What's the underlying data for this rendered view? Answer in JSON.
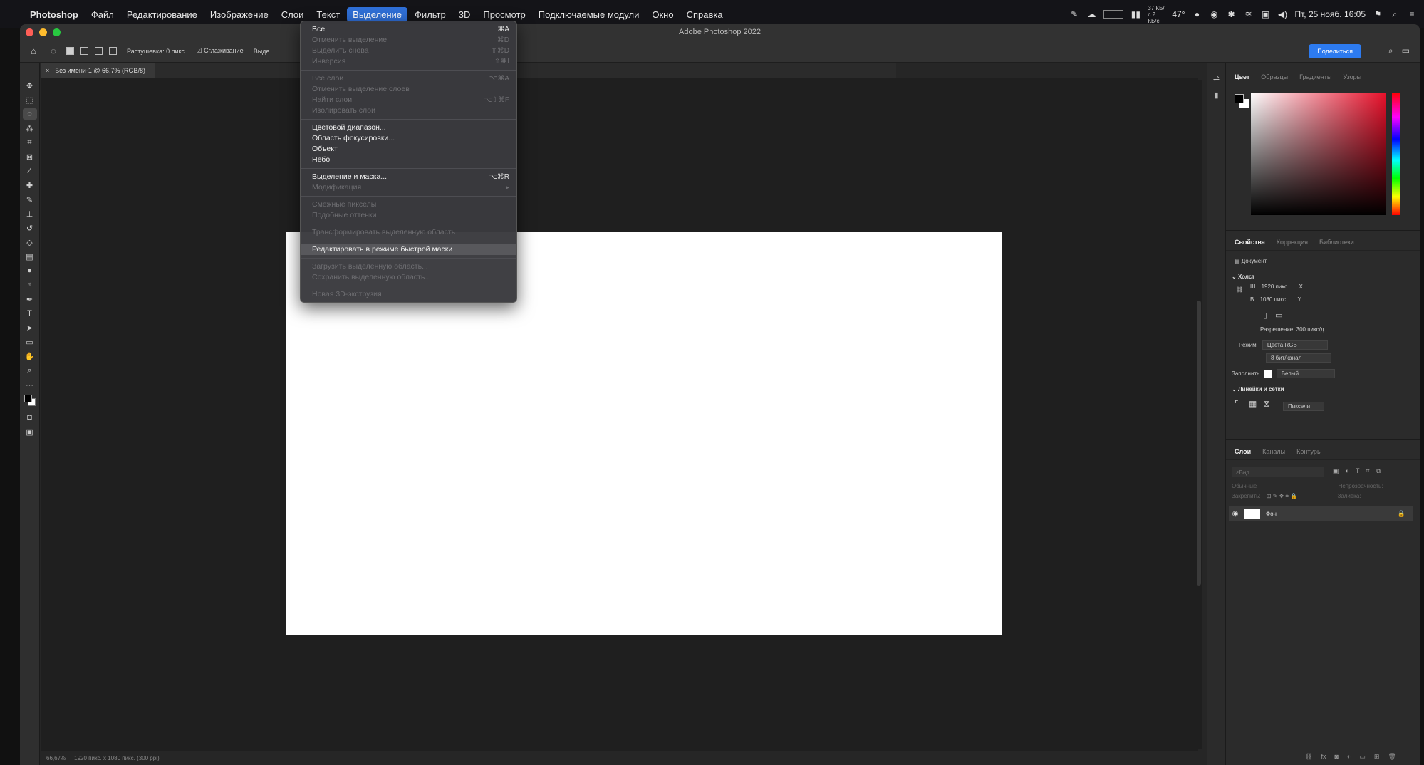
{
  "menubar": {
    "app_name": "Photoshop",
    "items": [
      "Файл",
      "Редактирование",
      "Изображение",
      "Слои",
      "Текст",
      "Выделение",
      "Фильтр",
      "3D",
      "Просмотр",
      "Подключаемые модули",
      "Окно",
      "Справка"
    ],
    "active_index": 5,
    "status": {
      "net_speed": "37 КБ/с 2 КБ/с",
      "temperature": "47°",
      "clock": "Пт, 25 нояб. 16:05"
    }
  },
  "window": {
    "title": "Adobe Photoshop 2022"
  },
  "options_bar": {
    "feather": "Растушевка: 0 пикс.",
    "anti_alias": "☑ Сглаживание",
    "select_label": "Выде",
    "share_button": "Поделиться"
  },
  "document_tab": {
    "name": "Без имени-1 @ 66,7% (RGB/8)"
  },
  "status_bar": {
    "zoom": "66,67%",
    "info": "1920 пикс. x 1080 пикс. (300 ppi)"
  },
  "select_menu": {
    "groups": [
      [
        {
          "label": "Все",
          "shortcut": "⌘A",
          "enabled": true
        },
        {
          "label": "Отменить выделение",
          "shortcut": "⌘D",
          "enabled": false
        },
        {
          "label": "Выделить снова",
          "shortcut": "⇧⌘D",
          "enabled": false
        },
        {
          "label": "Инверсия",
          "shortcut": "⇧⌘I",
          "enabled": false
        }
      ],
      [
        {
          "label": "Все слои",
          "shortcut": "⌥⌘A",
          "enabled": false
        },
        {
          "label": "Отменить выделение слоев",
          "shortcut": "",
          "enabled": false
        },
        {
          "label": "Найти слои",
          "shortcut": "⌥⇧⌘F",
          "enabled": false
        },
        {
          "label": "Изолировать слои",
          "shortcut": "",
          "enabled": false
        }
      ],
      [
        {
          "label": "Цветовой диапазон...",
          "shortcut": "",
          "enabled": true
        },
        {
          "label": "Область фокусировки...",
          "shortcut": "",
          "enabled": true
        },
        {
          "label": "Объект",
          "shortcut": "",
          "enabled": true
        },
        {
          "label": "Небо",
          "shortcut": "",
          "enabled": true
        }
      ],
      [
        {
          "label": "Выделение и маска...",
          "shortcut": "⌥⌘R",
          "enabled": true
        },
        {
          "label": "Модификация",
          "shortcut": "▸",
          "enabled": false
        }
      ],
      [
        {
          "label": "Смежные пикселы",
          "shortcut": "",
          "enabled": false
        },
        {
          "label": "Подобные оттенки",
          "shortcut": "",
          "enabled": false
        }
      ],
      [
        {
          "label": "Трансформировать выделенную область",
          "shortcut": "",
          "enabled": false
        }
      ],
      [
        {
          "label": "Редактировать в режиме быстрой маски",
          "shortcut": "",
          "enabled": true,
          "highlight": true
        }
      ],
      [
        {
          "label": "Загрузить выделенную область...",
          "shortcut": "",
          "enabled": false
        },
        {
          "label": "Сохранить выделенную область...",
          "shortcut": "",
          "enabled": false
        }
      ],
      [
        {
          "label": "Новая 3D-экструзия",
          "shortcut": "",
          "enabled": false
        }
      ]
    ]
  },
  "color_panel": {
    "tabs": [
      "Цвет",
      "Образцы",
      "Градиенты",
      "Узоры"
    ],
    "accent_hue": "#e8102a"
  },
  "properties_panel": {
    "tabs": [
      "Свойства",
      "Коррекция",
      "Библиотеки"
    ],
    "document_label": "Документ",
    "canvas_header": "Холст",
    "width": "1920 пикс.",
    "width_label": "Ш",
    "height": "1080 пикс.",
    "height_label": "В",
    "x_label": "X",
    "y_label": "Y",
    "resolution": "Разрешение: 300 пикс/д...",
    "mode_label": "Режим",
    "mode_value": "Цвета RGB",
    "depth_value": "8 бит/канал",
    "fill_label": "Заполнить",
    "fill_value": "Белый",
    "rulers_header": "Линейки и сетки",
    "units_value": "Пиксели"
  },
  "layers_panel": {
    "tabs": [
      "Слои",
      "Каналы",
      "Контуры"
    ],
    "search_placeholder": "Вид",
    "blend_mode": "Обычные",
    "opacity_label": "Непрозрачность:",
    "lock_label": "Закрепить:",
    "fill_label": "Заливка:",
    "layer_name": "Фон"
  }
}
